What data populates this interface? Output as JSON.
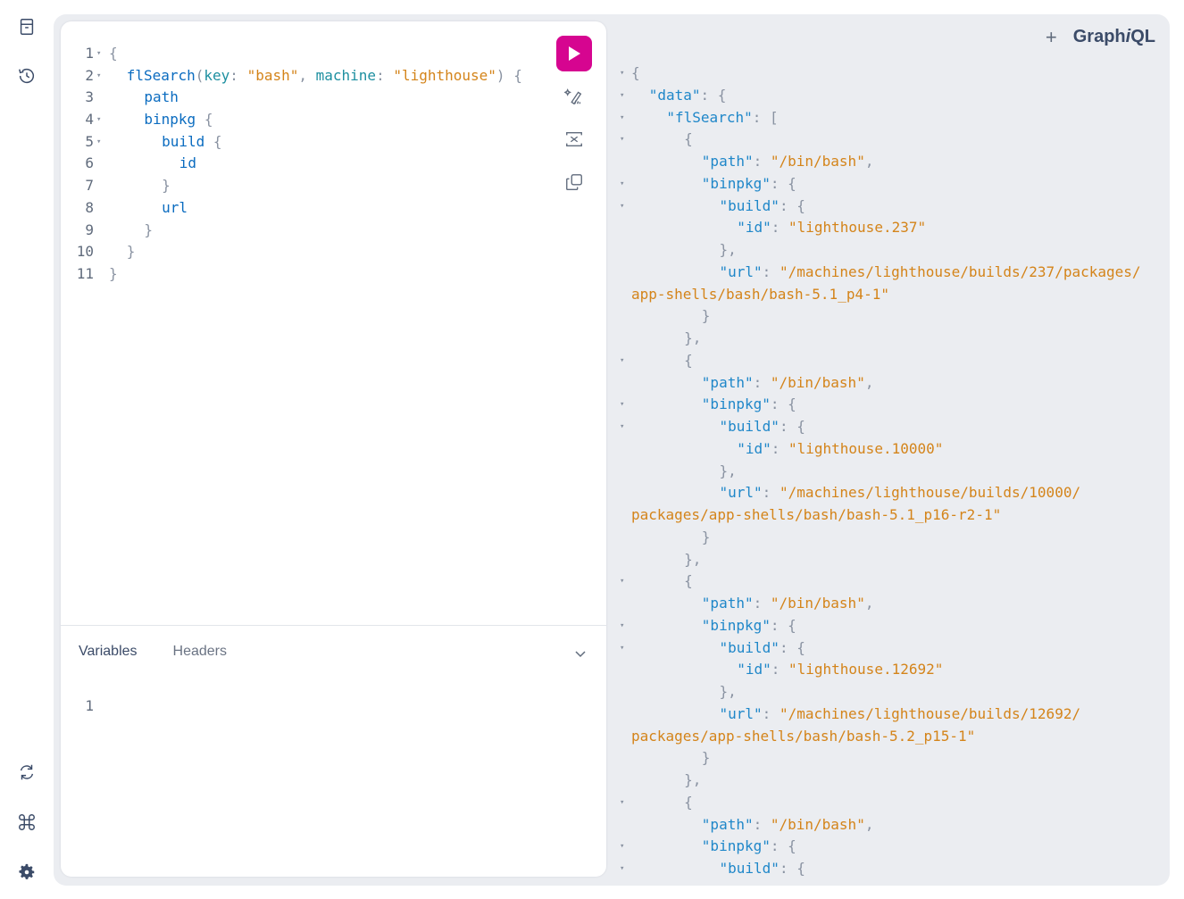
{
  "app": {
    "logo_prefix": "Graph",
    "logo_italic": "i",
    "logo_suffix": "QL"
  },
  "sidebar": {
    "top": [
      {
        "name": "docs-icon",
        "label": "Documentation Explorer"
      },
      {
        "name": "history-icon",
        "label": "History"
      }
    ],
    "bottom": [
      {
        "name": "refetch-icon",
        "label": "Re-fetch schema"
      },
      {
        "name": "shortcuts-icon",
        "label": "Shortcuts"
      },
      {
        "name": "settings-icon",
        "label": "Settings"
      }
    ]
  },
  "toolbar": {
    "run": "run-icon",
    "prettify": "prettify-icon",
    "merge": "merge-icon",
    "copy": "copy-icon",
    "add_tab": "+"
  },
  "query": {
    "lines": [
      {
        "n": "1",
        "fold": true,
        "indent": 0,
        "tokens": [
          [
            "{",
            "punc"
          ]
        ]
      },
      {
        "n": "2",
        "fold": true,
        "indent": 1,
        "tokens": [
          [
            "flSearch",
            "field"
          ],
          [
            "(",
            "punc"
          ],
          [
            "key",
            "arg"
          ],
          [
            ": ",
            "punc"
          ],
          [
            "\"bash\"",
            "str"
          ],
          [
            ", ",
            "punc"
          ],
          [
            "machine",
            "arg"
          ],
          [
            ": ",
            "punc"
          ],
          [
            "\"lighthouse\"",
            "str"
          ],
          [
            ") {",
            "punc"
          ]
        ]
      },
      {
        "n": "3",
        "fold": false,
        "indent": 2,
        "tokens": [
          [
            "path",
            "field"
          ]
        ]
      },
      {
        "n": "4",
        "fold": true,
        "indent": 2,
        "tokens": [
          [
            "binpkg",
            "field"
          ],
          [
            " {",
            "punc"
          ]
        ]
      },
      {
        "n": "5",
        "fold": true,
        "indent": 3,
        "tokens": [
          [
            "build",
            "field"
          ],
          [
            " {",
            "punc"
          ]
        ]
      },
      {
        "n": "6",
        "fold": false,
        "indent": 4,
        "tokens": [
          [
            "id",
            "field"
          ]
        ]
      },
      {
        "n": "7",
        "fold": false,
        "indent": 3,
        "tokens": [
          [
            "}",
            "punc"
          ]
        ]
      },
      {
        "n": "8",
        "fold": false,
        "indent": 3,
        "tokens": [
          [
            "url",
            "field"
          ]
        ]
      },
      {
        "n": "9",
        "fold": false,
        "indent": 2,
        "tokens": [
          [
            "}",
            "punc"
          ]
        ]
      },
      {
        "n": "10",
        "fold": false,
        "indent": 1,
        "tokens": [
          [
            "}",
            "punc"
          ]
        ]
      },
      {
        "n": "11",
        "fold": false,
        "indent": 0,
        "tokens": [
          [
            "}",
            "punc"
          ]
        ]
      }
    ]
  },
  "variables": {
    "tabs": [
      {
        "label": "Variables",
        "active": true
      },
      {
        "label": "Headers",
        "active": false
      }
    ],
    "lines": [
      {
        "n": "1",
        "text": ""
      }
    ]
  },
  "result": {
    "lines": [
      {
        "fold": true,
        "indent": 0,
        "tokens": [
          [
            "{",
            "punc"
          ]
        ]
      },
      {
        "fold": true,
        "indent": 1,
        "tokens": [
          [
            "\"data\"",
            "key"
          ],
          [
            ": {",
            "punc"
          ]
        ]
      },
      {
        "fold": true,
        "indent": 2,
        "tokens": [
          [
            "\"flSearch\"",
            "key"
          ],
          [
            ": [",
            "punc"
          ]
        ]
      },
      {
        "fold": true,
        "indent": 3,
        "tokens": [
          [
            "{",
            "punc"
          ]
        ]
      },
      {
        "fold": false,
        "indent": 4,
        "tokens": [
          [
            "\"path\"",
            "key"
          ],
          [
            ": ",
            "punc"
          ],
          [
            "\"/bin/bash\"",
            "str"
          ],
          [
            ",",
            "punc"
          ]
        ]
      },
      {
        "fold": true,
        "indent": 4,
        "tokens": [
          [
            "\"binpkg\"",
            "key"
          ],
          [
            ": {",
            "punc"
          ]
        ]
      },
      {
        "fold": true,
        "indent": 5,
        "tokens": [
          [
            "\"build\"",
            "key"
          ],
          [
            ": {",
            "punc"
          ]
        ]
      },
      {
        "fold": false,
        "indent": 6,
        "tokens": [
          [
            "\"id\"",
            "key"
          ],
          [
            ": ",
            "punc"
          ],
          [
            "\"lighthouse.237\"",
            "str"
          ]
        ]
      },
      {
        "fold": false,
        "indent": 5,
        "tokens": [
          [
            "},",
            "punc"
          ]
        ]
      },
      {
        "fold": false,
        "indent": 5,
        "tokens": [
          [
            "\"url\"",
            "key"
          ],
          [
            ": ",
            "punc"
          ],
          [
            "\"/machines/lighthouse/builds/237/packages/",
            "str"
          ]
        ]
      },
      {
        "fold": false,
        "indent": 0,
        "tokens": [
          [
            "app-shells/bash/bash-5.1_p4-1\"",
            "str"
          ]
        ]
      },
      {
        "fold": false,
        "indent": 4,
        "tokens": [
          [
            "}",
            "punc"
          ]
        ]
      },
      {
        "fold": false,
        "indent": 3,
        "tokens": [
          [
            "},",
            "punc"
          ]
        ]
      },
      {
        "fold": true,
        "indent": 3,
        "tokens": [
          [
            "{",
            "punc"
          ]
        ]
      },
      {
        "fold": false,
        "indent": 4,
        "tokens": [
          [
            "\"path\"",
            "key"
          ],
          [
            ": ",
            "punc"
          ],
          [
            "\"/bin/bash\"",
            "str"
          ],
          [
            ",",
            "punc"
          ]
        ]
      },
      {
        "fold": true,
        "indent": 4,
        "tokens": [
          [
            "\"binpkg\"",
            "key"
          ],
          [
            ": {",
            "punc"
          ]
        ]
      },
      {
        "fold": true,
        "indent": 5,
        "tokens": [
          [
            "\"build\"",
            "key"
          ],
          [
            ": {",
            "punc"
          ]
        ]
      },
      {
        "fold": false,
        "indent": 6,
        "tokens": [
          [
            "\"id\"",
            "key"
          ],
          [
            ": ",
            "punc"
          ],
          [
            "\"lighthouse.10000\"",
            "str"
          ]
        ]
      },
      {
        "fold": false,
        "indent": 5,
        "tokens": [
          [
            "},",
            "punc"
          ]
        ]
      },
      {
        "fold": false,
        "indent": 5,
        "tokens": [
          [
            "\"url\"",
            "key"
          ],
          [
            ": ",
            "punc"
          ],
          [
            "\"/machines/lighthouse/builds/10000/",
            "str"
          ]
        ]
      },
      {
        "fold": false,
        "indent": 0,
        "tokens": [
          [
            "packages/app-shells/bash/bash-5.1_p16-r2-1\"",
            "str"
          ]
        ]
      },
      {
        "fold": false,
        "indent": 4,
        "tokens": [
          [
            "}",
            "punc"
          ]
        ]
      },
      {
        "fold": false,
        "indent": 3,
        "tokens": [
          [
            "},",
            "punc"
          ]
        ]
      },
      {
        "fold": true,
        "indent": 3,
        "tokens": [
          [
            "{",
            "punc"
          ]
        ]
      },
      {
        "fold": false,
        "indent": 4,
        "tokens": [
          [
            "\"path\"",
            "key"
          ],
          [
            ": ",
            "punc"
          ],
          [
            "\"/bin/bash\"",
            "str"
          ],
          [
            ",",
            "punc"
          ]
        ]
      },
      {
        "fold": true,
        "indent": 4,
        "tokens": [
          [
            "\"binpkg\"",
            "key"
          ],
          [
            ": {",
            "punc"
          ]
        ]
      },
      {
        "fold": true,
        "indent": 5,
        "tokens": [
          [
            "\"build\"",
            "key"
          ],
          [
            ": {",
            "punc"
          ]
        ]
      },
      {
        "fold": false,
        "indent": 6,
        "tokens": [
          [
            "\"id\"",
            "key"
          ],
          [
            ": ",
            "punc"
          ],
          [
            "\"lighthouse.12692\"",
            "str"
          ]
        ]
      },
      {
        "fold": false,
        "indent": 5,
        "tokens": [
          [
            "},",
            "punc"
          ]
        ]
      },
      {
        "fold": false,
        "indent": 5,
        "tokens": [
          [
            "\"url\"",
            "key"
          ],
          [
            ": ",
            "punc"
          ],
          [
            "\"/machines/lighthouse/builds/12692/",
            "str"
          ]
        ]
      },
      {
        "fold": false,
        "indent": 0,
        "tokens": [
          [
            "packages/app-shells/bash/bash-5.2_p15-1\"",
            "str"
          ]
        ]
      },
      {
        "fold": false,
        "indent": 4,
        "tokens": [
          [
            "}",
            "punc"
          ]
        ]
      },
      {
        "fold": false,
        "indent": 3,
        "tokens": [
          [
            "},",
            "punc"
          ]
        ]
      },
      {
        "fold": true,
        "indent": 3,
        "tokens": [
          [
            "{",
            "punc"
          ]
        ]
      },
      {
        "fold": false,
        "indent": 4,
        "tokens": [
          [
            "\"path\"",
            "key"
          ],
          [
            ": ",
            "punc"
          ],
          [
            "\"/bin/bash\"",
            "str"
          ],
          [
            ",",
            "punc"
          ]
        ]
      },
      {
        "fold": true,
        "indent": 4,
        "tokens": [
          [
            "\"binpkg\"",
            "key"
          ],
          [
            ": {",
            "punc"
          ]
        ]
      },
      {
        "fold": true,
        "indent": 5,
        "tokens": [
          [
            "\"build\"",
            "key"
          ],
          [
            ": {",
            "punc"
          ]
        ]
      }
    ]
  },
  "colors": {
    "accent": "#d60590",
    "field": "#0b6cc0",
    "argument": "#1d8fa0",
    "string": "#d4841a",
    "punctuation": "#8a93a2",
    "json_key": "#1f87c9"
  }
}
